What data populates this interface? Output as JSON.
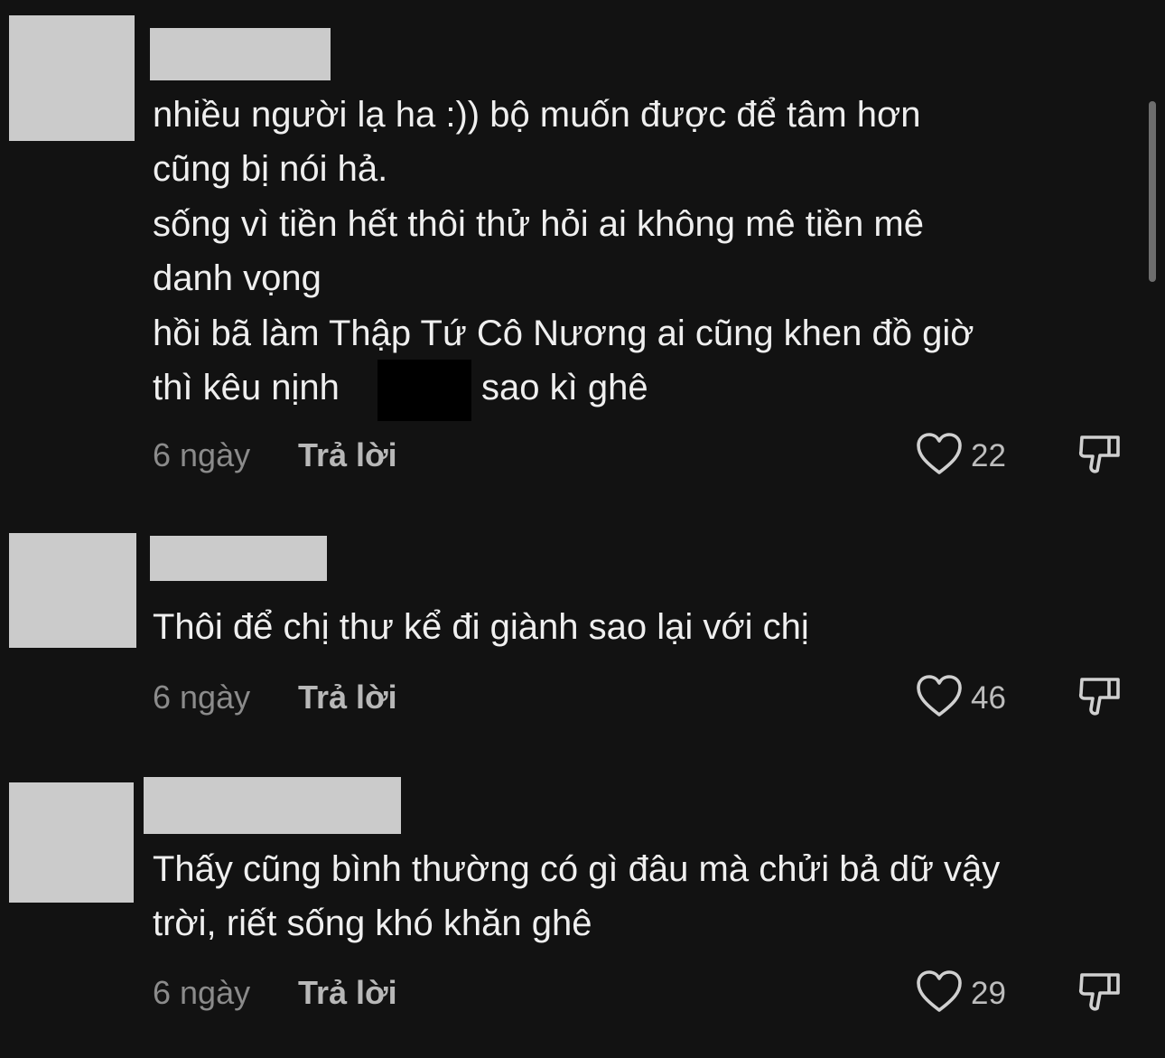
{
  "comments": [
    {
      "lines": [
        "nhiều người lạ ha :)) bộ muốn được để tâm hơn",
        "cũng bị nói hả.",
        "sống vì tiền hết thôi thử hỏi ai không mê tiền mê",
        "danh vọng",
        "hồi bã làm Thập Tứ Cô Nương ai cũng khen đồ giờ"
      ],
      "last_line_before": "thì kêu nịnh",
      "last_line_after": "sao kì ghê",
      "time": "6 ngày",
      "reply": "Trả lời",
      "likes": "22"
    },
    {
      "lines": [
        "Thôi để chị thư kể đi giành sao lại với chị"
      ],
      "time": "6 ngày",
      "reply": "Trả lời",
      "likes": "46"
    },
    {
      "lines": [
        "Thấy cũng bình thường có gì đâu mà chửi bả dữ vậy",
        "trời, riết sống khó khăn ghê"
      ],
      "time": "6 ngày",
      "reply": "Trả lời",
      "likes": "29"
    }
  ],
  "icons": {
    "like": "heart-outline-icon",
    "dislike": "thumbs-down-icon"
  },
  "colors": {
    "background": "#121212",
    "placeholder": "#cbcbcb",
    "text": "#efefef",
    "muted": "#8b8b8b"
  }
}
